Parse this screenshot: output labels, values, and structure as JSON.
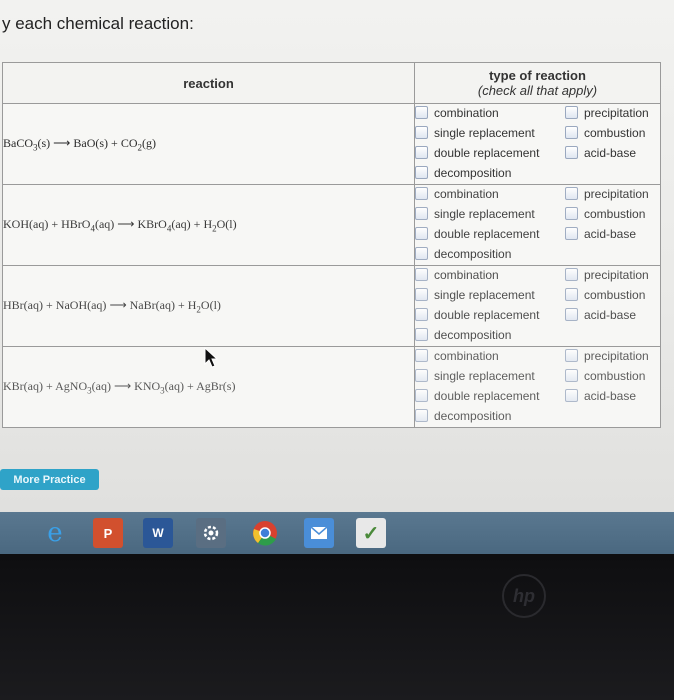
{
  "instruction": "y each chemical reaction:",
  "table": {
    "header_reaction": "reaction",
    "header_type": "type of reaction",
    "header_type_sub": "(check all that apply)",
    "option_labels": {
      "combination": "combination",
      "precipitation": "precipitation",
      "single_replacement": "single replacement",
      "combustion": "combustion",
      "double_replacement": "double replacement",
      "acid_base": "acid-base",
      "decomposition": "decomposition"
    },
    "rows": [
      {
        "equation": {
          "r1": "BaCO",
          "r1_sub": "3",
          "r1_state": "(s)",
          "arrow": "⟶",
          "p1": "BaO",
          "p1_state": "(s)",
          "plus": "+",
          "p2": "CO",
          "p2_sub": "2",
          "p2_state": "(g)"
        },
        "checked": []
      },
      {
        "equation": {
          "r1": "KOH",
          "r1_state": "(aq)",
          "plus1": "+",
          "r2": "HBrO",
          "r2_sub": "4",
          "r2_state": "(aq)",
          "arrow": "⟶",
          "p1": "KBrO",
          "p1_sub": "4",
          "p1_state": "(aq)",
          "plus2": "+",
          "p2": "H",
          "p2_sub": "2",
          "p2_tail": "O",
          "p2_state": "(l)"
        },
        "checked": []
      },
      {
        "equation": {
          "r1": "HBr",
          "r1_state": "(aq)",
          "plus1": "+",
          "r2": "NaOH",
          "r2_state": "(aq)",
          "arrow": "⟶",
          "p1": "NaBr",
          "p1_state": "(aq)",
          "plus2": "+",
          "p2": "H",
          "p2_sub": "2",
          "p2_tail": "O",
          "p2_state": "(l)"
        },
        "checked": []
      },
      {
        "equation": {
          "r1": "KBr",
          "r1_state": "(aq)",
          "plus1": "+",
          "r2": "AgNO",
          "r2_sub": "3",
          "r2_state": "(aq)",
          "arrow": "⟶",
          "p1": "KNO",
          "p1_sub": "3",
          "p1_state": "(aq)",
          "plus2": "+",
          "p2": "AgBr",
          "p2_state": "(s)"
        },
        "checked": []
      }
    ]
  },
  "more_practice_label": "More Practice",
  "taskbar": {
    "icons": [
      "internet-explorer-icon",
      "powerpoint-icon",
      "word-icon",
      "settings-icon",
      "chrome-icon",
      "mail-icon",
      "check-icon"
    ],
    "powerpoint_glyph": "P",
    "word_glyph": "W",
    "ie_glyph": "e",
    "check_glyph": "✓"
  },
  "colors": {
    "more_practice_bg": "#2fa3c8",
    "taskbar_bg": "#4f6d85",
    "checkbox_border": "#9aa8bf"
  }
}
